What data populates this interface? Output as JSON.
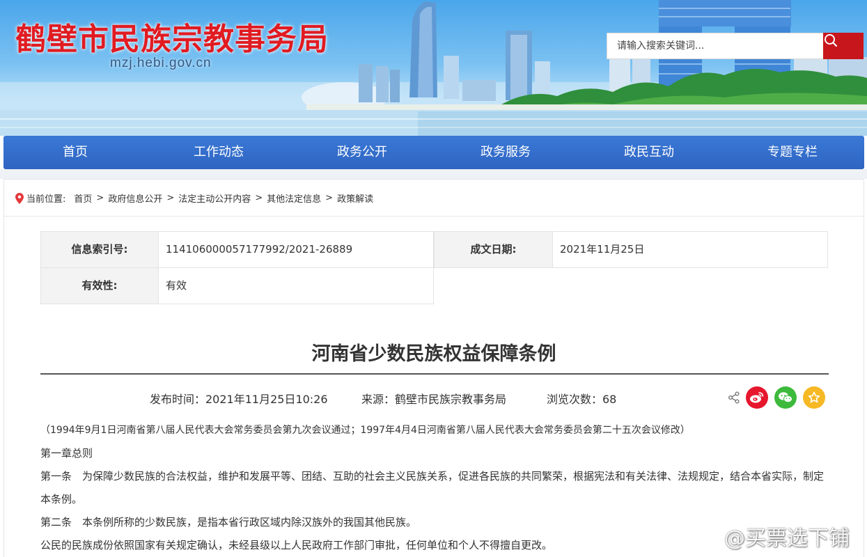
{
  "header": {
    "site_title": "鹤壁市民族宗教事务局",
    "site_domain": "mzj.hebi.gov.cn",
    "search_placeholder": "请输入搜索关键词..."
  },
  "nav": [
    "首页",
    "工作动态",
    "政务公开",
    "政务服务",
    "政民互动",
    "专题专栏"
  ],
  "breadcrumb": {
    "label": "当前位置:",
    "items": [
      "首页",
      "政府信息公开",
      "法定主动公开内容",
      "其他法定信息",
      "政策解读"
    ]
  },
  "info": {
    "index_label": "信息索引号:",
    "index_value": "114106000057177992/2021-26889",
    "date_label": "成文日期:",
    "date_value": "2021年11月25日",
    "validity_label": "有效性:",
    "validity_value": "有效"
  },
  "article": {
    "title": "河南省少数民族权益保障条例",
    "publish_time": "发布时间：2021年11月25日10:26",
    "source": "来源：鹤壁市民族宗教事务局",
    "views": "浏览次数：68",
    "paragraphs": [
      "（1994年9月1日河南省第八届人民代表大会常务委员会第九次会议通过；1997年4月4日河南省第八届人民代表大会常务委员会第二十五次会议修改）",
      "第一章总则",
      "第一条　为保障少数民族的合法权益，维护和发展平等、团结、互助的社会主义民族关系，促进各民族的共同繁荣，根据宪法和有关法律、法规规定，结合本省实际，制定本条例。",
      "第二条　本条例所称的少数民族，是指本省行政区域内除汉族外的我国其他民族。",
      "公民的民族成份依照国家有关规定确认，未经县级以上人民政府工作部门审批，任何单位和个人不得擅自更改。"
    ]
  },
  "watermark": "@买票选下铺",
  "colors": {
    "brand_red": "#e11b22",
    "nav_blue": "#3a79d6",
    "search_red": "#c8161d",
    "weibo_red": "#e6162d",
    "wechat_green": "#3dba3c",
    "favorite_yellow": "#f6b824"
  }
}
